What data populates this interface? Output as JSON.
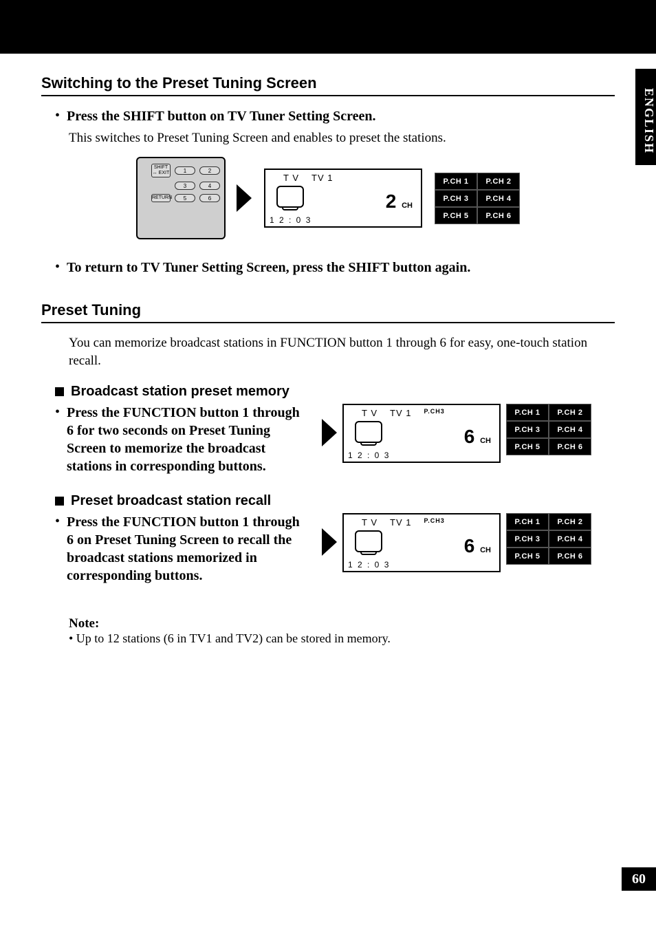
{
  "sideTab": "ENGLISH",
  "pageNumber": "60",
  "section1": {
    "title": "Switching to the Preset Tuning Screen",
    "bullet1": "Press the SHIFT button on TV Tuner Setting Screen.",
    "desc1": "This switches to Preset Tuning Screen and enables to preset the stations.",
    "bullet2": "To return to TV Tuner Setting Screen, press the SHIFT button again."
  },
  "section2": {
    "title": "Preset Tuning",
    "intro": "You can memorize broadcast stations in FUNCTION button 1 through 6 for easy, one-touch station recall.",
    "sub1": {
      "heading": "Broadcast station preset memory",
      "bullet": "Press the FUNCTION button 1 through 6 for two seconds on Preset Tuning Screen to memorize the broadcast stations in corresponding buttons."
    },
    "sub2": {
      "heading": "Preset broadcast station recall",
      "bullet": "Press the FUNCTION button 1 through 6 on Preset Tuning Screen to recall the broadcast stations memorized in corresponding buttons."
    }
  },
  "note": {
    "title": "Note:",
    "text": "•  Up to 12 stations (6 in TV1  and TV2) can be stored in memory."
  },
  "remote": {
    "shift": "SHIFT ↔ EXIT",
    "return": "RETURN",
    "b1": "1",
    "b2": "2",
    "b3": "3",
    "b4": "4",
    "b5": "5",
    "b6": "6"
  },
  "tvScreen1": {
    "label1": "T V",
    "label2": "TV 1",
    "channel": "2",
    "chUnit": "CH",
    "time": "1 2 : 0 3"
  },
  "tvScreen2": {
    "label1": "T V",
    "label2": "TV 1",
    "pch": "P.CH3",
    "channel": "6",
    "chUnit": "CH",
    "time": "1 2 : 0 3"
  },
  "tvScreen3": {
    "label1": "T V",
    "label2": "TV 1",
    "pch": "P.CH3",
    "channel": "6",
    "chUnit": "CH",
    "time": "1 2 : 0 3"
  },
  "pch": {
    "c1": "P.CH 1",
    "c2": "P.CH 2",
    "c3": "P.CH 3",
    "c4": "P.CH 4",
    "c5": "P.CH 5",
    "c6": "P.CH 6"
  }
}
